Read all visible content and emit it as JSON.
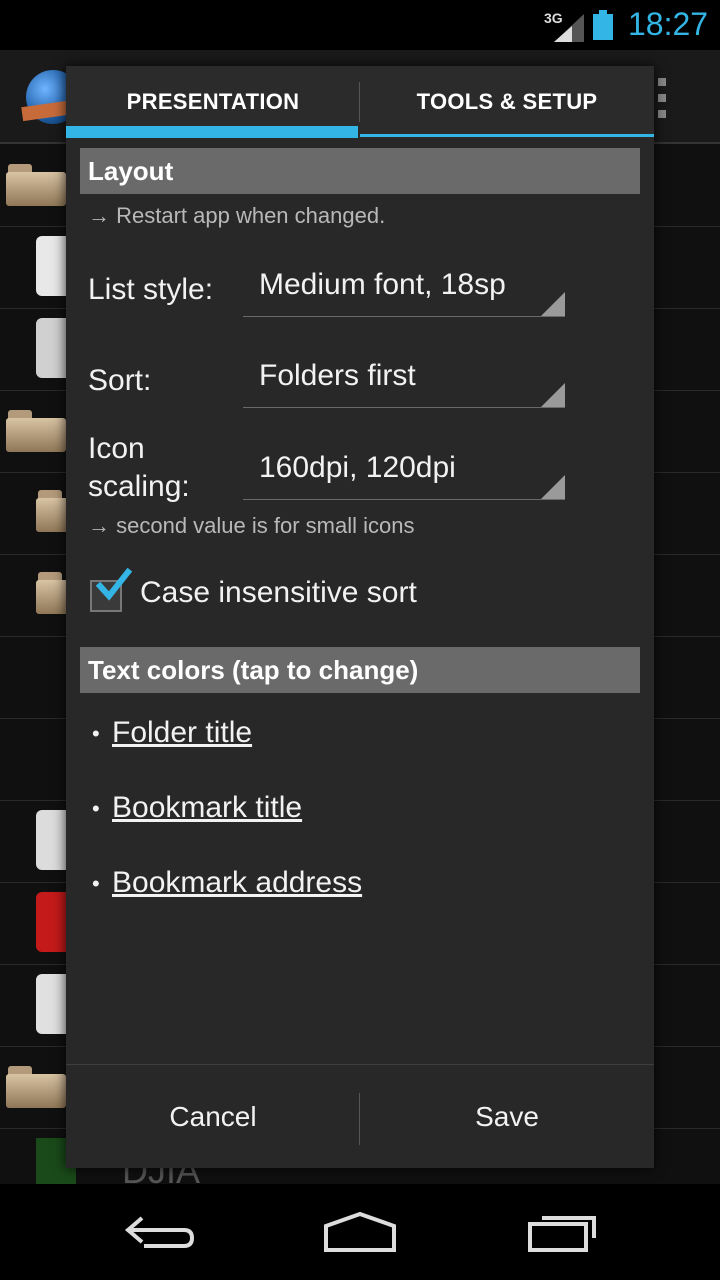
{
  "status_bar": {
    "network": "3G",
    "time": "18:27",
    "accent_color": "#33b5e5"
  },
  "background": {
    "visible_text": "DJIA",
    "icons": [
      "app-logo-icon",
      "overflow-menu-icon",
      "folder-icon",
      "gmail-icon",
      "play-store-icon",
      "bbc-icon",
      "cnn-icon",
      "amazon-icon"
    ]
  },
  "dialog": {
    "tabs": [
      {
        "label": "PRESENTATION",
        "selected": true
      },
      {
        "label": "TOOLS & SETUP",
        "selected": false
      }
    ],
    "layout_section": {
      "title": "Layout",
      "restart_hint": "→ Restart app when changed."
    },
    "list_style": {
      "label": "List style:",
      "value": "Medium font, 18sp"
    },
    "sort": {
      "label": "Sort:",
      "value": "Folders first"
    },
    "icon_scaling": {
      "label_line1": "Icon",
      "label_line2": "scaling:",
      "value": "160dpi, 120dpi"
    },
    "icon_hint": "→ second value is for small icons",
    "case_insensitive": {
      "label": "Case insensitive sort",
      "checked": true
    },
    "colors_section": {
      "title": "Text colors (tap to change)"
    },
    "color_links": [
      {
        "bullet": "•",
        "label": "Folder title"
      },
      {
        "bullet": "•",
        "label": "Bookmark title"
      },
      {
        "bullet": "•",
        "label": "Bookmark address"
      }
    ],
    "buttons": {
      "cancel": "Cancel",
      "save": "Save"
    }
  },
  "nav_bar": {
    "icons": [
      "back-icon",
      "home-icon",
      "recent-apps-icon"
    ]
  }
}
